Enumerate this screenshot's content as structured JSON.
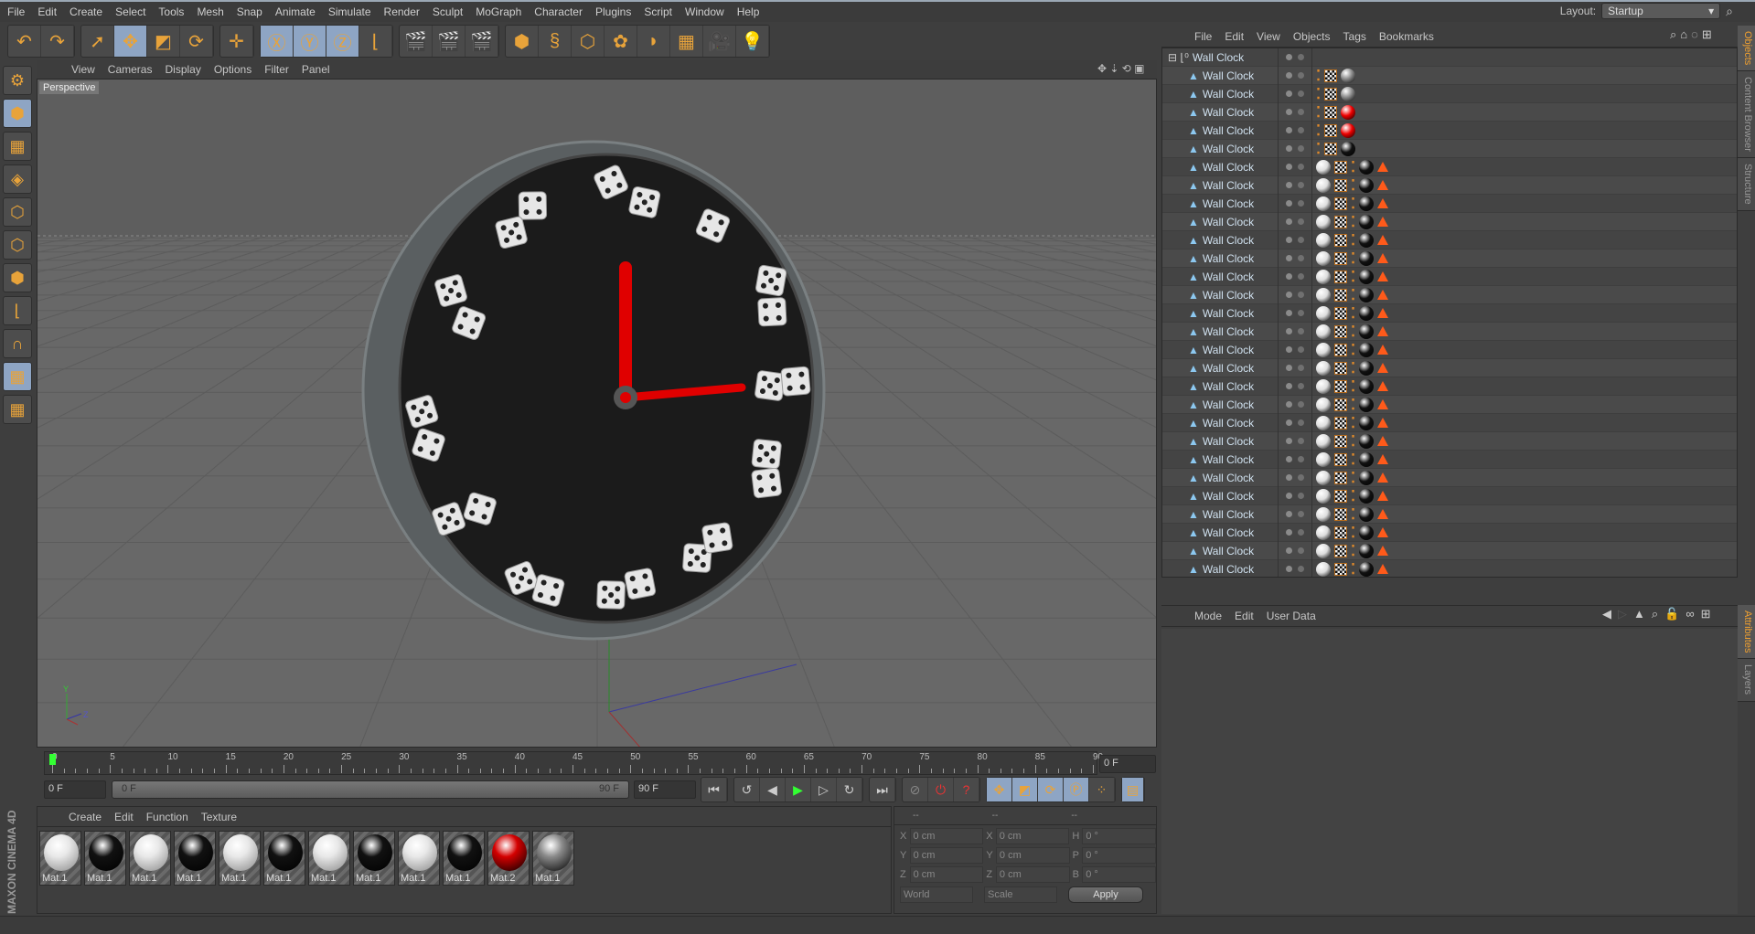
{
  "menu": [
    "File",
    "Edit",
    "Create",
    "Select",
    "Tools",
    "Mesh",
    "Snap",
    "Animate",
    "Simulate",
    "Render",
    "Sculpt",
    "MoGraph",
    "Character",
    "Plugins",
    "Script",
    "Window",
    "Help"
  ],
  "layout": {
    "label": "Layout:",
    "value": "Startup"
  },
  "toolbar": [
    [
      {
        "icon": "undo-icon",
        "g": "↶"
      },
      {
        "icon": "redo-icon",
        "g": "↷"
      }
    ],
    [
      {
        "icon": "select-arrow-icon",
        "g": "➚"
      },
      {
        "icon": "move-icon",
        "g": "✥",
        "on": true
      },
      {
        "icon": "scale-icon",
        "g": "◩"
      },
      {
        "icon": "rotate-icon",
        "g": "⟳"
      }
    ],
    [
      {
        "icon": "live-move-icon",
        "g": "✛"
      }
    ],
    [
      {
        "icon": "x-axis-lock-icon",
        "g": "Ⓧ",
        "on": true
      },
      {
        "icon": "y-axis-lock-icon",
        "g": "Ⓨ",
        "on": true
      },
      {
        "icon": "z-axis-lock-icon",
        "g": "Ⓩ",
        "on": true
      },
      {
        "icon": "coordinate-system-icon",
        "g": "⌊"
      }
    ],
    [
      {
        "icon": "render-view-icon",
        "g": "🎬"
      },
      {
        "icon": "render-picture-viewer-icon",
        "g": "🎬"
      },
      {
        "icon": "render-settings-icon",
        "g": "🎬"
      }
    ],
    [
      {
        "icon": "cube-icon",
        "g": "⬢"
      },
      {
        "icon": "spline-icon",
        "g": "§"
      },
      {
        "icon": "subdivision-icon",
        "g": "⬡"
      },
      {
        "icon": "cloner-icon",
        "g": "✿"
      },
      {
        "icon": "deformer-icon",
        "g": "◗"
      },
      {
        "icon": "floor-icon",
        "g": "▦"
      },
      {
        "icon": "camera-icon",
        "g": "🎥"
      },
      {
        "icon": "light-icon",
        "g": "💡"
      }
    ]
  ],
  "left_tools": [
    {
      "icon": "make-editable-icon",
      "g": "⚙"
    },
    {
      "icon": "model-mode-icon",
      "g": "⬢",
      "on": true
    },
    {
      "icon": "texture-mode-icon",
      "g": "▦"
    },
    {
      "icon": "workplane-icon",
      "g": "◈"
    },
    {
      "icon": "points-mode-icon",
      "g": "⬡"
    },
    {
      "icon": "edges-mode-icon",
      "g": "⬡"
    },
    {
      "icon": "polygons-mode-icon",
      "g": "⬢"
    },
    {
      "icon": "axis-mode-icon",
      "g": "⌊"
    },
    {
      "icon": "snap-icon",
      "g": "∩"
    },
    {
      "icon": "workplane-lock-icon",
      "g": "▦",
      "on": true
    },
    {
      "icon": "planar-workplane-icon",
      "g": "▦"
    }
  ],
  "viewport": {
    "menu": [
      "View",
      "Cameras",
      "Display",
      "Options",
      "Filter",
      "Panel"
    ],
    "camera": "Perspective",
    "axis": {
      "y": "Y",
      "z": "Z"
    }
  },
  "timeline": {
    "ticks": [
      "0",
      "5",
      "10",
      "15",
      "20",
      "25",
      "30",
      "35",
      "40",
      "45",
      "50",
      "55",
      "60",
      "65",
      "70",
      "75",
      "80",
      "85",
      "90"
    ],
    "current": "0 F",
    "start": "0 F",
    "slider_start": "0 F",
    "slider_end": "90 F",
    "end": "90 F"
  },
  "materials": {
    "menu": [
      "Create",
      "Edit",
      "Function",
      "Texture"
    ],
    "items": [
      {
        "name": "Mat.1",
        "color": "#e8e8e8"
      },
      {
        "name": "Mat.1",
        "color": "#111111"
      },
      {
        "name": "Mat.1",
        "color": "#e8e8e8"
      },
      {
        "name": "Mat.1",
        "color": "#111111"
      },
      {
        "name": "Mat.1",
        "color": "#e8e8e8"
      },
      {
        "name": "Mat.1",
        "color": "#111111"
      },
      {
        "name": "Mat.1",
        "color": "#e8e8e8"
      },
      {
        "name": "Mat.1",
        "color": "#111111"
      },
      {
        "name": "Mat.1",
        "color": "#e8e8e8"
      },
      {
        "name": "Mat.1",
        "color": "#111111"
      },
      {
        "name": "Mat.2",
        "color": "#d40000"
      },
      {
        "name": "Mat.1",
        "color": "#8a8a8a"
      }
    ]
  },
  "coords": {
    "headers": [
      "--",
      "--",
      "--"
    ],
    "rows": [
      {
        "a": "X",
        "av": "0 cm",
        "b": "X",
        "bv": "0 cm",
        "c": "H",
        "cv": "0 °"
      },
      {
        "a": "Y",
        "av": "0 cm",
        "b": "Y",
        "bv": "0 cm",
        "c": "P",
        "cv": "0 °"
      },
      {
        "a": "Z",
        "av": "0 cm",
        "b": "Z",
        "bv": "0 cm",
        "c": "B",
        "cv": "0 °"
      }
    ],
    "mode": "World",
    "size": "Scale",
    "apply": "Apply"
  },
  "objects": {
    "menu": [
      "File",
      "Edit",
      "View",
      "Objects",
      "Tags",
      "Bookmarks"
    ],
    "root": "Wall Clock",
    "children": [
      {
        "name": "Wall Clock",
        "tags": [
          "dots",
          "checker",
          "chrome"
        ]
      },
      {
        "name": "Wall Clock",
        "tags": [
          "dots",
          "checker",
          "chrome"
        ]
      },
      {
        "name": "Wall Clock",
        "tags": [
          "dots",
          "checker",
          "red"
        ]
      },
      {
        "name": "Wall Clock",
        "tags": [
          "dots",
          "checker",
          "red"
        ]
      },
      {
        "name": "Wall Clock",
        "tags": [
          "dots",
          "checker",
          "black"
        ]
      },
      {
        "name": "Wall Clock",
        "tags": [
          "white",
          "checker",
          "dots",
          "black",
          "triangle"
        ]
      },
      {
        "name": "Wall Clock",
        "tags": [
          "white",
          "checker",
          "dots",
          "black",
          "triangle"
        ]
      },
      {
        "name": "Wall Clock",
        "tags": [
          "white",
          "checker",
          "dots",
          "black",
          "triangle"
        ]
      },
      {
        "name": "Wall Clock",
        "tags": [
          "white",
          "checker",
          "dots",
          "black",
          "triangle"
        ]
      },
      {
        "name": "Wall Clock",
        "tags": [
          "white",
          "checker",
          "dots",
          "black",
          "triangle"
        ]
      },
      {
        "name": "Wall Clock",
        "tags": [
          "white",
          "checker",
          "dots",
          "black",
          "triangle"
        ]
      },
      {
        "name": "Wall Clock",
        "tags": [
          "white",
          "checker",
          "dots",
          "black",
          "triangle"
        ]
      },
      {
        "name": "Wall Clock",
        "tags": [
          "white",
          "checker",
          "dots",
          "black",
          "triangle"
        ]
      },
      {
        "name": "Wall Clock",
        "tags": [
          "white",
          "checker",
          "dots",
          "black",
          "triangle"
        ]
      },
      {
        "name": "Wall Clock",
        "tags": [
          "white",
          "checker",
          "dots",
          "black",
          "triangle"
        ]
      },
      {
        "name": "Wall Clock",
        "tags": [
          "white",
          "checker",
          "dots",
          "black",
          "triangle"
        ]
      },
      {
        "name": "Wall Clock",
        "tags": [
          "white",
          "checker",
          "dots",
          "black",
          "triangle"
        ]
      },
      {
        "name": "Wall Clock",
        "tags": [
          "white",
          "checker",
          "dots",
          "black",
          "triangle"
        ]
      },
      {
        "name": "Wall Clock",
        "tags": [
          "white",
          "checker",
          "dots",
          "black",
          "triangle"
        ]
      },
      {
        "name": "Wall Clock",
        "tags": [
          "white",
          "checker",
          "dots",
          "black",
          "triangle"
        ]
      },
      {
        "name": "Wall Clock",
        "tags": [
          "white",
          "checker",
          "dots",
          "black",
          "triangle"
        ]
      },
      {
        "name": "Wall Clock",
        "tags": [
          "white",
          "checker",
          "dots",
          "black",
          "triangle"
        ]
      },
      {
        "name": "Wall Clock",
        "tags": [
          "white",
          "checker",
          "dots",
          "black",
          "triangle"
        ]
      },
      {
        "name": "Wall Clock",
        "tags": [
          "white",
          "checker",
          "dots",
          "black",
          "triangle"
        ]
      },
      {
        "name": "Wall Clock",
        "tags": [
          "white",
          "checker",
          "dots",
          "black",
          "triangle"
        ]
      },
      {
        "name": "Wall Clock",
        "tags": [
          "white",
          "checker",
          "dots",
          "black",
          "triangle"
        ]
      },
      {
        "name": "Wall Clock",
        "tags": [
          "white",
          "checker",
          "dots",
          "black",
          "triangle"
        ]
      },
      {
        "name": "Wall Clock",
        "tags": [
          "white",
          "checker",
          "dots",
          "black",
          "triangle"
        ]
      }
    ]
  },
  "attributes": {
    "menu": [
      "Mode",
      "Edit",
      "User Data"
    ]
  },
  "side_tabs": {
    "top": [
      "Objects",
      "Content Browser",
      "Structure"
    ],
    "bottom": [
      "Attributes",
      "Layers"
    ]
  },
  "brand": "MAXON CINEMA 4D",
  "colors": {
    "accent": "#f0a030",
    "hand": "#e00000",
    "selected": "#8ea5c4"
  }
}
